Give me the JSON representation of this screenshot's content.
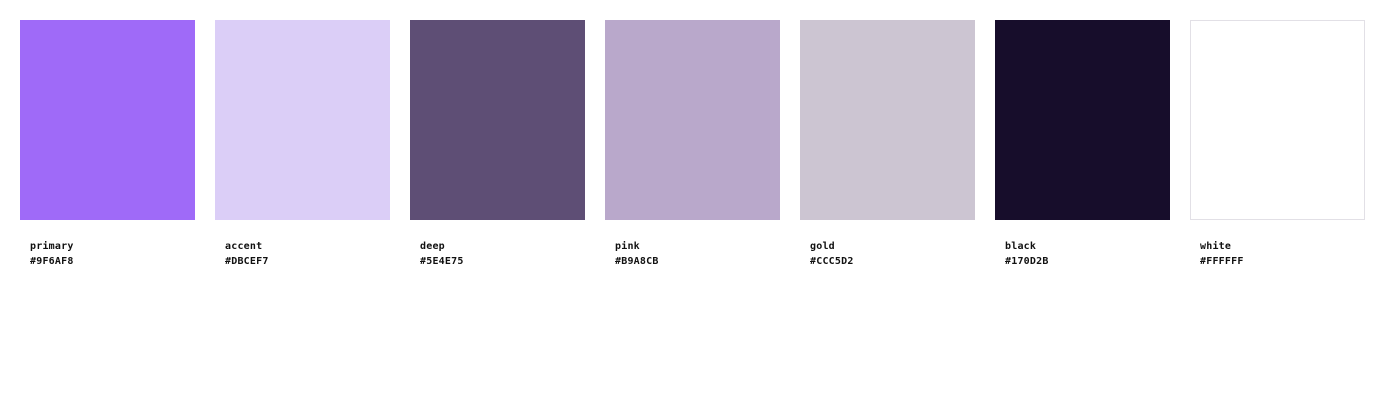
{
  "swatches": [
    {
      "name": "primary",
      "hex": "#9F6AF8",
      "color": "#9F6AF8"
    },
    {
      "name": "accent",
      "hex": "#DBCEF7",
      "color": "#DBCEF7"
    },
    {
      "name": "deep",
      "hex": "#5E4E75",
      "color": "#5E4E75"
    },
    {
      "name": "pink",
      "hex": "#B9A8CB",
      "color": "#B9A8CB"
    },
    {
      "name": "gold",
      "hex": "#CCC5D2",
      "color": "#CCC5D2"
    },
    {
      "name": "black",
      "hex": "#170D2B",
      "color": "#170D2B"
    },
    {
      "name": "white",
      "hex": "#FFFFFF",
      "color": "#FFFFFF"
    }
  ]
}
